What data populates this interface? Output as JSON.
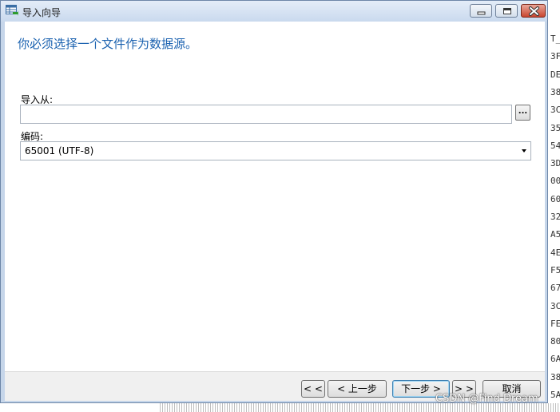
{
  "window": {
    "title": "导入向导",
    "minimize_icon": "minimize-icon",
    "maximize_icon": "maximize-icon",
    "close_icon": "close-icon"
  },
  "main": {
    "heading": "你必须选择一个文件作为数据源。",
    "import_from": {
      "label": "导入从:",
      "value": "",
      "browse_label": "..."
    },
    "encoding": {
      "label": "编码:",
      "selected": "65001 (UTF-8)"
    }
  },
  "footer": {
    "first_label": "< <",
    "back_label": "< 上一步",
    "next_label": "下一步 >",
    "last_label": "> >",
    "cancel_label": "取消"
  },
  "background": {
    "strip_chars": [
      "T_",
      "3F",
      "DE",
      "38",
      "3C",
      "35",
      "54",
      "3D",
      "00",
      "60",
      "32",
      "A5",
      "4E",
      "F5",
      "67",
      "3C",
      "FE",
      "80",
      "6A",
      "38",
      "5A"
    ],
    "watermark": "CSDN @Find Dream"
  },
  "colors": {
    "frame": "#c6d6ea",
    "heading": "#1b62b0",
    "close_button": "#c9452f"
  }
}
